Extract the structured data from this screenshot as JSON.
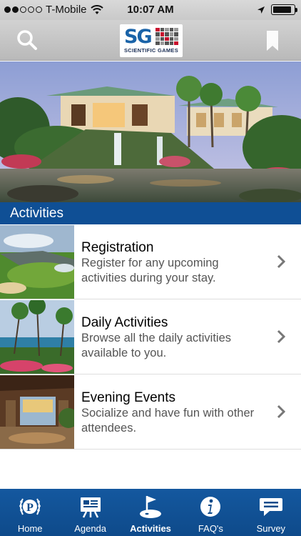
{
  "status_bar": {
    "carrier": "T-Mobile",
    "time": "10:07 AM",
    "signal_bars_filled": 2,
    "signal_bars_total": 5,
    "battery_level": 0.9
  },
  "header": {
    "logo_text": "SG",
    "logo_subtitle": "SCIENTIFIC GAMES",
    "left_icon": "search-icon",
    "right_icon": "bookmark-icon"
  },
  "section": {
    "title": "Activities"
  },
  "items": [
    {
      "title": "Registration",
      "description": "Register for any upcoming activities during your stay.",
      "thumbnail": "golf-course-image",
      "icon": "chevron-right-icon"
    },
    {
      "title": "Daily Activities",
      "description": "Browse all the daily activities available to you.",
      "thumbnail": "beach-palms-image",
      "icon": "chevron-right-icon"
    },
    {
      "title": "Evening Events",
      "description": "Socialize and have fun with other attendees.",
      "thumbnail": "resort-lounge-image",
      "icon": "chevron-right-icon"
    }
  ],
  "tabs": [
    {
      "label": "Home",
      "icon": "laurel-p-icon",
      "active": false
    },
    {
      "label": "Agenda",
      "icon": "easel-icon",
      "active": false
    },
    {
      "label": "Activities",
      "icon": "golf-flag-icon",
      "active": true
    },
    {
      "label": "FAQ's",
      "icon": "info-icon",
      "active": false
    },
    {
      "label": "Survey",
      "icon": "speech-bubble-icon",
      "active": false
    }
  ],
  "colors": {
    "brand_blue": "#0f4f95",
    "logo_blue": "#1a63a8",
    "logo_red": "#c8102e"
  }
}
